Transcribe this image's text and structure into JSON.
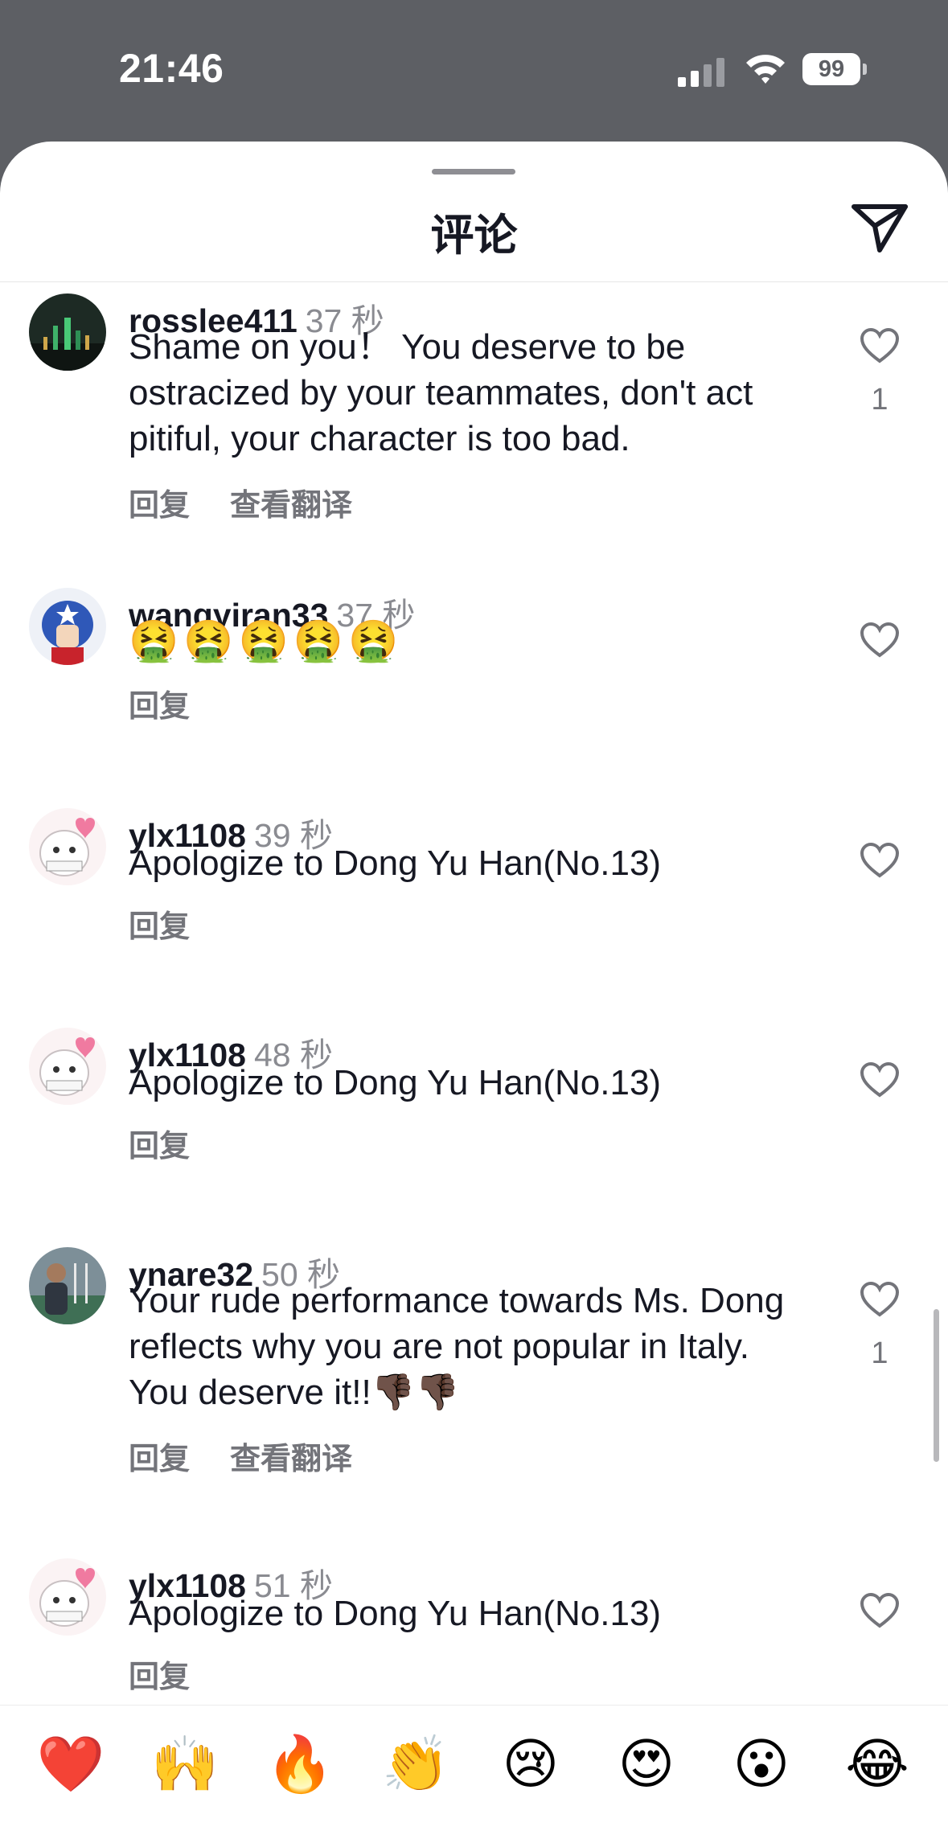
{
  "status_bar": {
    "time": "21:46",
    "battery": "99"
  },
  "sheet": {
    "title": "评论"
  },
  "comments": [
    {
      "username": "rosslee411",
      "time": "37 秒",
      "text": "Shame on you！ You deserve to be ostracized by your teammates, don't act pitiful, your character is too bad.",
      "likes": "1",
      "reply": "回复",
      "translate": "查看翻译"
    },
    {
      "username": "wangyiran33",
      "time": "37 秒",
      "text": "🤮🤮🤮🤮🤮",
      "reply": "回复"
    },
    {
      "username": "ylx1108",
      "time": "39 秒",
      "text": "Apologize to Dong Yu Han(No.13)",
      "reply": "回复"
    },
    {
      "username": "ylx1108",
      "time": "48 秒",
      "text": "Apologize to Dong Yu Han(No.13)",
      "reply": "回复"
    },
    {
      "username": "ynare32",
      "time": "50 秒",
      "text": "Your rude performance towards Ms. Dong reflects why you are not popular in Italy. You deserve it!!👎🏿👎🏿",
      "likes": "1",
      "reply": "回复",
      "translate": "查看翻译"
    },
    {
      "username": "ylx1108",
      "time": "51 秒",
      "text": "Apologize to Dong Yu Han(No.13)",
      "reply": "回复"
    }
  ],
  "reactions": [
    "❤️",
    "🙌",
    "🔥",
    "👏",
    "😢",
    "😍",
    "😮",
    "😂"
  ],
  "icons": {
    "status": [
      "signal-icon",
      "wifi-icon",
      "battery-icon"
    ],
    "header": [
      "send-icon"
    ],
    "comment": [
      "heart-outline-icon",
      "avatar"
    ]
  },
  "colors": {
    "text": "#161823",
    "secondary": "#8a8b91",
    "action": "#73747a",
    "status_bg": "#5d5f64"
  }
}
